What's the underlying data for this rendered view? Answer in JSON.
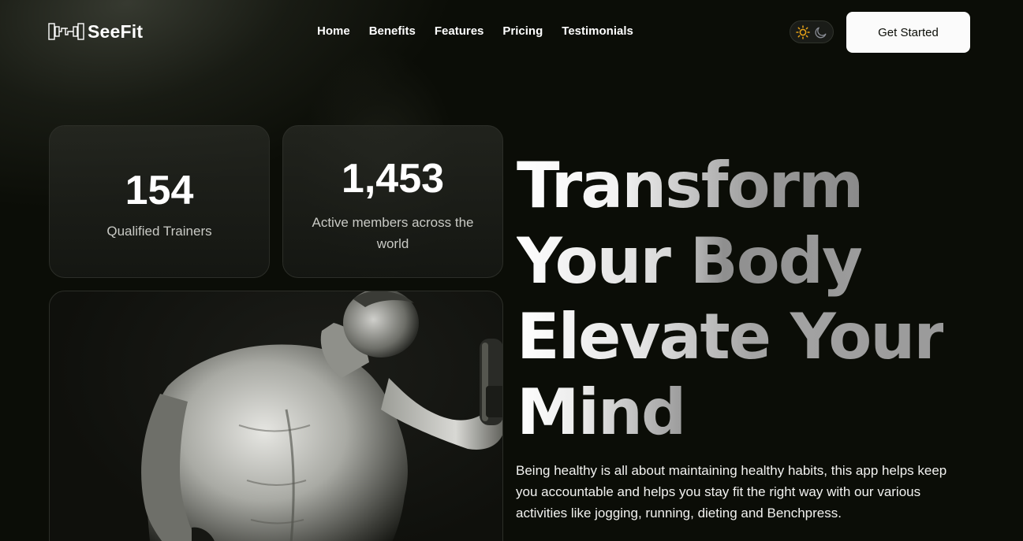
{
  "brand": {
    "name": "SeeFit",
    "logo_icon": "dumbbell-logo-icon"
  },
  "nav": {
    "items": [
      {
        "label": "Home"
      },
      {
        "label": "Benefits"
      },
      {
        "label": "Features"
      },
      {
        "label": "Pricing"
      },
      {
        "label": "Testimonials"
      }
    ],
    "theme_toggle": {
      "light_icon": "sun-icon",
      "dark_icon": "moon-icon",
      "active": "light"
    },
    "cta_label": "Get Started"
  },
  "stats": [
    {
      "value": "154",
      "label": "Qualified Trainers"
    },
    {
      "value": "1,453",
      "label": "Active members across the world"
    }
  ],
  "hero": {
    "headline_lines": [
      "Transform",
      "Your Body",
      "Elevate Your",
      "Mind"
    ],
    "description": "Being healthy is all about maintaining healthy habits, this app helps keep you accountable and helps you stay fit the right way with our various activities like jogging, running, dieting and Benchpress."
  },
  "colors": {
    "background": "#0b0d07",
    "cta_bg": "#fbfbfb",
    "sun": "#e8a317"
  }
}
